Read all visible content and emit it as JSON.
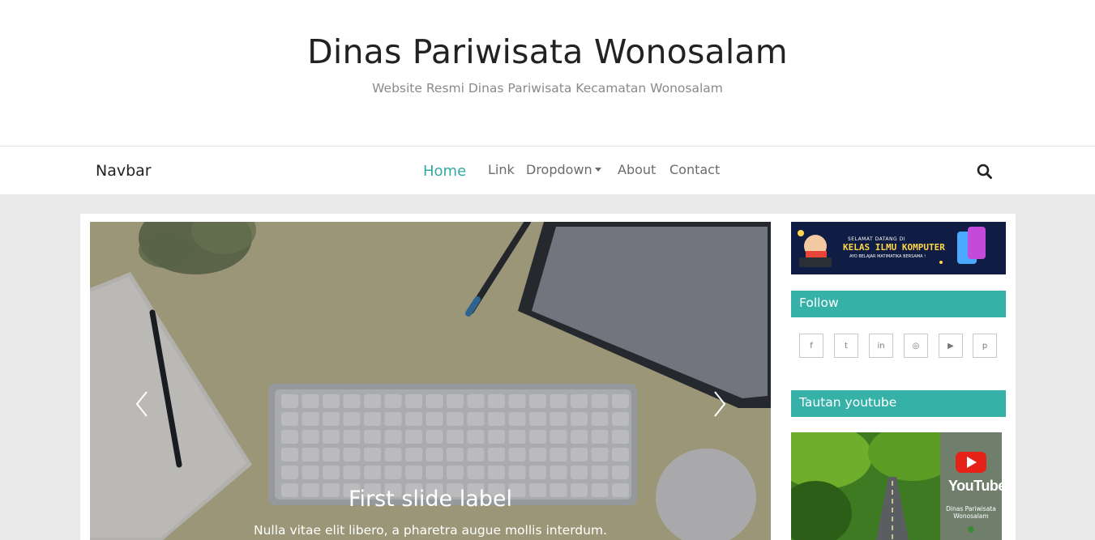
{
  "header": {
    "title": "Dinas Pariwisata Wonosalam",
    "tagline": "Website Resmi Dinas Pariwisata Kecamatan Wonosalam"
  },
  "navbar": {
    "brand": "Navbar",
    "items": [
      {
        "label": "Home",
        "active": true
      },
      {
        "label": "Link"
      },
      {
        "label": "Dropdown"
      },
      {
        "label": "About"
      },
      {
        "label": "Contact"
      }
    ],
    "search_icon": "search-icon"
  },
  "carousel": {
    "slide_title": "First slide label",
    "slide_text": "Nulla vitae elit libero, a pharetra augue mollis interdum.",
    "prev_icon": "chevron-left-icon",
    "next_icon": "chevron-right-icon"
  },
  "sidebar": {
    "banner": {
      "line1": "SELAMAT DATANG DI",
      "line2": "KELAS ILMU KOMPUTER",
      "line3": "AYO BELAJAR MATIMATIKA BERSAMA !"
    },
    "follow_title": "Follow",
    "social": [
      {
        "icon": "facebook-icon",
        "glyph": "f"
      },
      {
        "icon": "twitter-icon",
        "glyph": "t"
      },
      {
        "icon": "linkedin-icon",
        "glyph": "in"
      },
      {
        "icon": "instagram-icon",
        "glyph": "◎"
      },
      {
        "icon": "youtube-icon",
        "glyph": "▶"
      },
      {
        "icon": "pinterest-icon",
        "glyph": "p"
      }
    ],
    "youtube_title": "Tautan youtube",
    "youtube_thumb": {
      "word": "YouTube",
      "caption_line1": "Dinas Pariwisata",
      "caption_line2": "Wonosalam"
    }
  },
  "colors": {
    "accent": "#35b1a8",
    "nav_active": "#35a7a4",
    "page_bg": "#e9e9e9"
  }
}
